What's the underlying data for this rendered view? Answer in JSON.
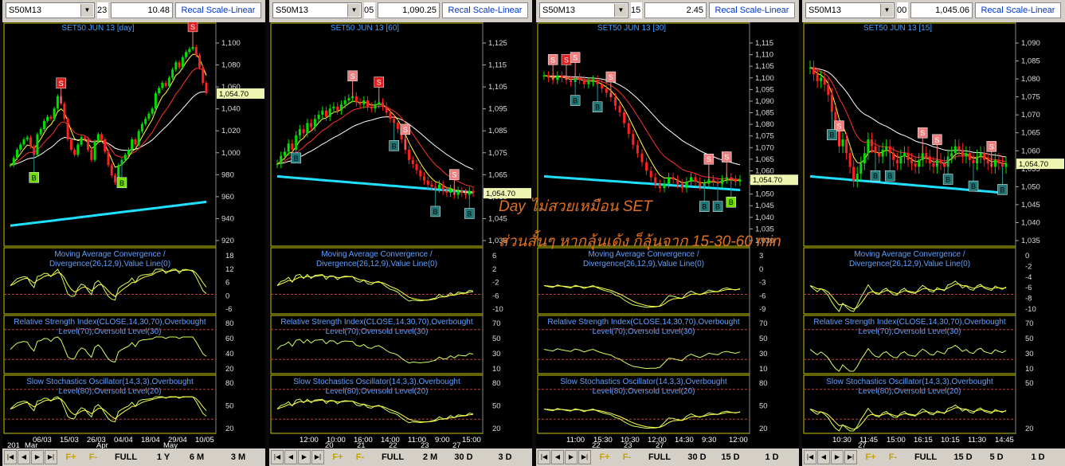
{
  "colors": {
    "bull": "#00e000",
    "bear": "#ff2020",
    "ma_fast": "#ffff40",
    "ma_mid": "#ff3030",
    "ma_slow": "#ffffff",
    "ma_long": "#20e0ff",
    "frame": "#c8c800",
    "osc": "#d0ff60",
    "annot": "#e07020"
  },
  "annotations": {
    "line1": "Day ไม่สวยเหมือน SET",
    "line2": "ส่วนสั้นๆ หากลุ้นเด้ง ก็ลุ้นจาก 15-30-60 min"
  },
  "panels": [
    {
      "symbol": "S50M13",
      "stub": "23",
      "value": "10.48",
      "recal": "Recal Scale-Linear",
      "title": "SET50 JUN 13   [day]",
      "price_label": "1,054.70",
      "y_ticks": [
        "1,100",
        "1,080",
        "1,060",
        "1,040",
        "1,020",
        "1,000",
        "980",
        "960",
        "940",
        "920"
      ],
      "macd_label": [
        "Moving Average Convergence /",
        "Divergence(26,12,9),Value Line(0)"
      ],
      "macd_ticks": [
        "18",
        "12",
        "6",
        "0",
        "-6"
      ],
      "rsi_label": [
        "Relative Strength Index(CLOSE,14,30,70),Overbought",
        "Level(70),Oversold Level(30)"
      ],
      "rsi_ticks": [
        "80",
        "60",
        "40",
        "20"
      ],
      "sto_label": [
        "Slow Stochastics Oscillator(14,3,3),Overbought",
        "Level(80),Oversold Level(20)"
      ],
      "sto_ticks": [
        "80",
        "50",
        "20"
      ],
      "x_row1": [
        "06/03",
        "15/03",
        "26/03",
        "04/04",
        "18/04",
        "29/04",
        "10/05"
      ],
      "x_row2": [
        "201",
        "Mar",
        "Apr",
        "May"
      ],
      "buttons": [
        "F+",
        "F-",
        "FULL",
        "1 Y",
        "6 M",
        "3 M"
      ],
      "signals": [
        {
          "t": "S",
          "c": "red",
          "i": 15
        },
        {
          "t": "S",
          "c": "red",
          "i": 54
        },
        {
          "t": "B",
          "c": "green",
          "i": 7
        },
        {
          "t": "B",
          "c": "green",
          "i": 33
        }
      ]
    },
    {
      "symbol": "S50M13",
      "stub": "05",
      "value": "1,090.25",
      "recal": "Recal Scale-Linear",
      "title": "SET50 JUN 13   [60]",
      "price_label": "1,054.70",
      "y_ticks": [
        "1,125",
        "1,115",
        "1,105",
        "1,095",
        "1,085",
        "1,075",
        "1,065",
        "1,055",
        "1,045",
        "1,035"
      ],
      "macd_label": [
        "Moving Average Convergence /",
        "Divergence(26,12,9),Value Line(0)"
      ],
      "macd_ticks": [
        "6",
        "2",
        "-2",
        "-6",
        "-10"
      ],
      "rsi_label": [
        "Relative Strength Index(CLOSE,14,30,70),Overbought",
        "Level(70),Oversold Level(30)"
      ],
      "rsi_ticks": [
        "70",
        "50",
        "30",
        "10"
      ],
      "sto_label": [
        "Slow Stochastics Oscillator(14,3,3),Overbought",
        "Level(80),Oversold Level(20)"
      ],
      "sto_ticks": [
        "80",
        "50",
        "20"
      ],
      "x_row1": [
        "12:00",
        "10:00",
        "16:00",
        "14:00",
        "11:00",
        "9:00",
        "15:00"
      ],
      "x_row2": [
        "20",
        "21",
        "22",
        "23",
        "27"
      ],
      "buttons": [
        "F+",
        "F-",
        "FULL",
        "2 M",
        "30 D",
        "3 D"
      ],
      "signals": [
        {
          "t": "S",
          "c": "pink",
          "i": 20
        },
        {
          "t": "S",
          "c": "red",
          "i": 27
        },
        {
          "t": "S",
          "c": "pink",
          "i": 34
        },
        {
          "t": "S",
          "c": "pink",
          "i": 47
        },
        {
          "t": "B",
          "c": "teal",
          "i": 5
        },
        {
          "t": "B",
          "c": "teal",
          "i": 31
        },
        {
          "t": "B",
          "c": "teal",
          "i": 42
        },
        {
          "t": "B",
          "c": "teal",
          "i": 51
        }
      ]
    },
    {
      "symbol": "S50M13",
      "stub": "15",
      "value": "2.45",
      "recal": "Recal Scale-Linear",
      "title": "SET50 JUN 13   [30]",
      "price_label": "1,054.70",
      "y_ticks": [
        "1,115",
        "1,110",
        "1,105",
        "1,100",
        "1,095",
        "1,090",
        "1,085",
        "1,080",
        "1,075",
        "1,070",
        "1,065",
        "1,060",
        "1,055",
        "1,050",
        "1,045",
        "1,040",
        "1,035",
        "1,030"
      ],
      "macd_label": [
        "Moving Average Convergence /",
        "Divergence(26,12,9),Value Line(0)"
      ],
      "macd_ticks": [
        "3",
        "0",
        "-3",
        "-6",
        "-9"
      ],
      "rsi_label": [
        "Relative Strength Index(CLOSE,14,30,70),Overbought",
        "Level(70),Oversold Level(30)"
      ],
      "rsi_ticks": [
        "70",
        "50",
        "30",
        "10"
      ],
      "sto_label": [
        "Slow Stochastics Oscillator(14,3,3),Overbought",
        "Level(80),Oversold Level(20)"
      ],
      "sto_ticks": [
        "80",
        "50",
        "20"
      ],
      "x_row1": [
        "11:00",
        "15:30",
        "10:30",
        "12:00",
        "14:30",
        "9:30",
        "12:00"
      ],
      "x_row2": [
        "22",
        "23",
        "27"
      ],
      "buttons": [
        "F+",
        "F-",
        "FULL",
        "30 D",
        "15 D",
        "1 D"
      ],
      "signals": [
        {
          "t": "S",
          "c": "pink",
          "i": 2
        },
        {
          "t": "S",
          "c": "red",
          "i": 5
        },
        {
          "t": "S",
          "c": "pink",
          "i": 7
        },
        {
          "t": "S",
          "c": "pink",
          "i": 15
        },
        {
          "t": "S",
          "c": "pink",
          "i": 37
        },
        {
          "t": "S",
          "c": "pink",
          "i": 41
        },
        {
          "t": "B",
          "c": "teal",
          "i": 7
        },
        {
          "t": "B",
          "c": "teal",
          "i": 12
        },
        {
          "t": "B",
          "c": "teal",
          "i": 36
        },
        {
          "t": "B",
          "c": "teal",
          "i": 39
        },
        {
          "t": "B",
          "c": "green",
          "i": 42
        }
      ]
    },
    {
      "symbol": "S50M13",
      "stub": "00",
      "value": "1,045.06",
      "recal": "Recal Scale-Linear",
      "title": "SET50 JUN 13   [15]",
      "price_label": "1,054.70",
      "y_ticks": [
        "1,090",
        "1,085",
        "1,080",
        "1,075",
        "1,070",
        "1,065",
        "1,060",
        "1,055",
        "1,050",
        "1,045",
        "1,040",
        "1,035"
      ],
      "macd_label": [
        "Moving Average Convergence /",
        "Divergence(26,12,9),Value Line(0)"
      ],
      "macd_ticks": [
        "0",
        "-2",
        "-4",
        "-6",
        "-8",
        "-10"
      ],
      "rsi_label": [
        "Relative Strength Index(CLOSE,14,30,70),Overbought",
        "Level(70),Oversold Level(30)"
      ],
      "rsi_ticks": [
        "70",
        "50",
        "30",
        "10"
      ],
      "sto_label": [
        "Slow Stochastics Oscillator(14,3,3),Overbought",
        "Level(80),Oversold Level(20)"
      ],
      "sto_ticks": [
        "50",
        "20"
      ],
      "x_row1": [
        "10:30",
        "11:45",
        "15:00",
        "16:15",
        "10:15",
        "11:30",
        "14:45"
      ],
      "x_row2": [
        "27"
      ],
      "buttons": [
        "F+",
        "F-",
        "FULL",
        "15 D",
        "5 D",
        "1 D"
      ],
      "signals": [
        {
          "t": "S",
          "c": "pink",
          "i": 8
        },
        {
          "t": "S",
          "c": "pink",
          "i": 31
        },
        {
          "t": "S",
          "c": "pink",
          "i": 35
        },
        {
          "t": "S",
          "c": "pink",
          "i": 50
        },
        {
          "t": "B",
          "c": "teal",
          "i": 6
        },
        {
          "t": "B",
          "c": "teal",
          "i": 18
        },
        {
          "t": "B",
          "c": "teal",
          "i": 22
        },
        {
          "t": "B",
          "c": "teal",
          "i": 38
        },
        {
          "t": "B",
          "c": "teal",
          "i": 45
        },
        {
          "t": "B",
          "c": "teal",
          "i": 53
        }
      ]
    }
  ],
  "chart_data": [
    {
      "type": "line",
      "title": "SET50 JUN 13 [day]",
      "series": [
        {
          "values": [
            985,
            992,
            1000,
            1005,
            1010,
            1012,
            1003,
            995,
            1015,
            1020,
            1028,
            1032,
            1030,
            1040,
            1052,
            1045,
            1030,
            1010,
            1000,
            995,
            1005,
            1012,
            1010,
            1000,
            990,
            1008,
            1015,
            1010,
            998,
            985,
            975,
            968,
            985,
            990,
            995,
            1000,
            1010,
            1005,
            1018,
            1025,
            1030,
            1035,
            1040,
            1055,
            1060,
            1065,
            1062,
            1070,
            1078,
            1085,
            1080,
            1090,
            1095,
            1098,
            1100,
            1092,
            1080,
            1065,
            1055
          ]
        }
      ],
      "ylim": [
        910,
        1110
      ]
    },
    {
      "type": "line",
      "title": "SET50 JUN 13 [60]",
      "series": [
        {
          "values": [
            1068,
            1072,
            1074,
            1078,
            1075,
            1082,
            1085,
            1083,
            1088,
            1086,
            1090,
            1092,
            1094,
            1091,
            1095,
            1096,
            1094,
            1097,
            1099,
            1100,
            1101,
            1098,
            1097,
            1099,
            1096,
            1095,
            1097,
            1098,
            1096,
            1093,
            1090,
            1088,
            1085,
            1080,
            1075,
            1070,
            1068,
            1065,
            1062,
            1060,
            1058,
            1057,
            1056,
            1058,
            1055,
            1054,
            1056,
            1053,
            1055,
            1054,
            1053,
            1055,
            1054
          ]
        }
      ],
      "ylim": [
        1030,
        1130
      ]
    },
    {
      "type": "line",
      "title": "SET50 JUN 13 [30]",
      "series": [
        {
          "values": [
            1102,
            1101,
            1100,
            1102,
            1101,
            1100,
            1099,
            1101,
            1100,
            1098,
            1099,
            1100,
            1098,
            1096,
            1094,
            1092,
            1088,
            1085,
            1080,
            1075,
            1070,
            1066,
            1062,
            1058,
            1055,
            1052,
            1050,
            1052,
            1055,
            1054,
            1052,
            1050,
            1053,
            1055,
            1053,
            1051,
            1052,
            1054,
            1053,
            1052,
            1054,
            1055,
            1054,
            1053,
            1054
          ]
        }
      ],
      "ylim": [
        1025,
        1120
      ]
    },
    {
      "type": "line",
      "title": "SET50 JUN 13 [15]",
      "series": [
        {
          "values": [
            1083,
            1081,
            1079,
            1080,
            1078,
            1075,
            1070,
            1065,
            1060,
            1062,
            1058,
            1054,
            1050,
            1052,
            1055,
            1058,
            1062,
            1060,
            1058,
            1057,
            1059,
            1060,
            1058,
            1056,
            1055,
            1057,
            1058,
            1056,
            1055,
            1054,
            1056,
            1058,
            1057,
            1055,
            1054,
            1056,
            1055,
            1054,
            1057,
            1058,
            1060,
            1059,
            1057,
            1058,
            1056,
            1055,
            1057,
            1058,
            1056,
            1055,
            1054,
            1056,
            1055,
            1054,
            1055
          ]
        }
      ],
      "ylim": [
        1032,
        1092
      ]
    }
  ]
}
